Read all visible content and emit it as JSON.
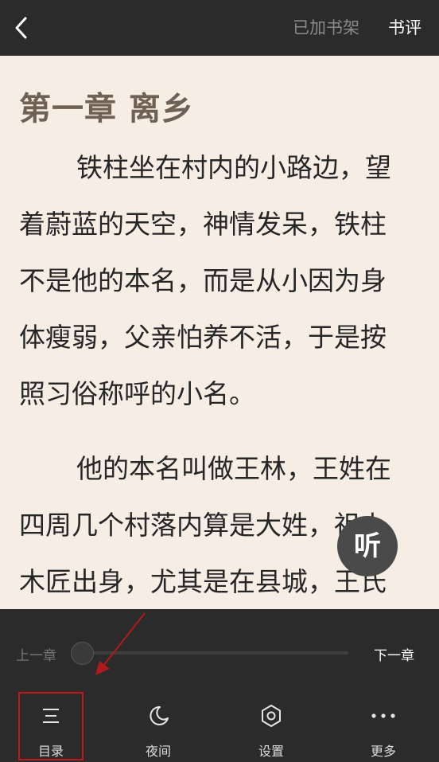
{
  "header": {
    "back_icon": "chevron-left-icon",
    "shelf_label": "已加书架",
    "review_label": "书评"
  },
  "content": {
    "chapter_title": "第一章 离乡",
    "paragraphs": [
      [
        "铁柱坐在村内的小路边，望",
        "着蔚蓝的天空，神情发呆，铁柱",
        "不是他的本名，而是从小因为身",
        "体瘦弱，父亲怕养不活，于是按",
        "照习俗称呼的小名。"
      ],
      [
        "他的本名叫做王林，王姓在",
        "四周几个村落内算是大姓，祖上",
        "木匠出身，尤其是在县城，王氏"
      ]
    ]
  },
  "listen_button": {
    "label": "听"
  },
  "progress": {
    "prev_label": "上一章",
    "next_label": "下一章",
    "value": 0
  },
  "bottom_nav": {
    "items": [
      {
        "label": "目录",
        "icon": "menu-list-icon",
        "highlighted": true
      },
      {
        "label": "夜间",
        "icon": "moon-icon"
      },
      {
        "label": "设置",
        "icon": "hexagon-settings-icon"
      },
      {
        "label": "更多",
        "icon": "more-dots-icon"
      }
    ]
  },
  "colors": {
    "bar_background": "#2b2b2b",
    "page_background": "#f6ede5",
    "highlight_box": "#c3171c",
    "annotation_arrow": "#b0191e"
  }
}
